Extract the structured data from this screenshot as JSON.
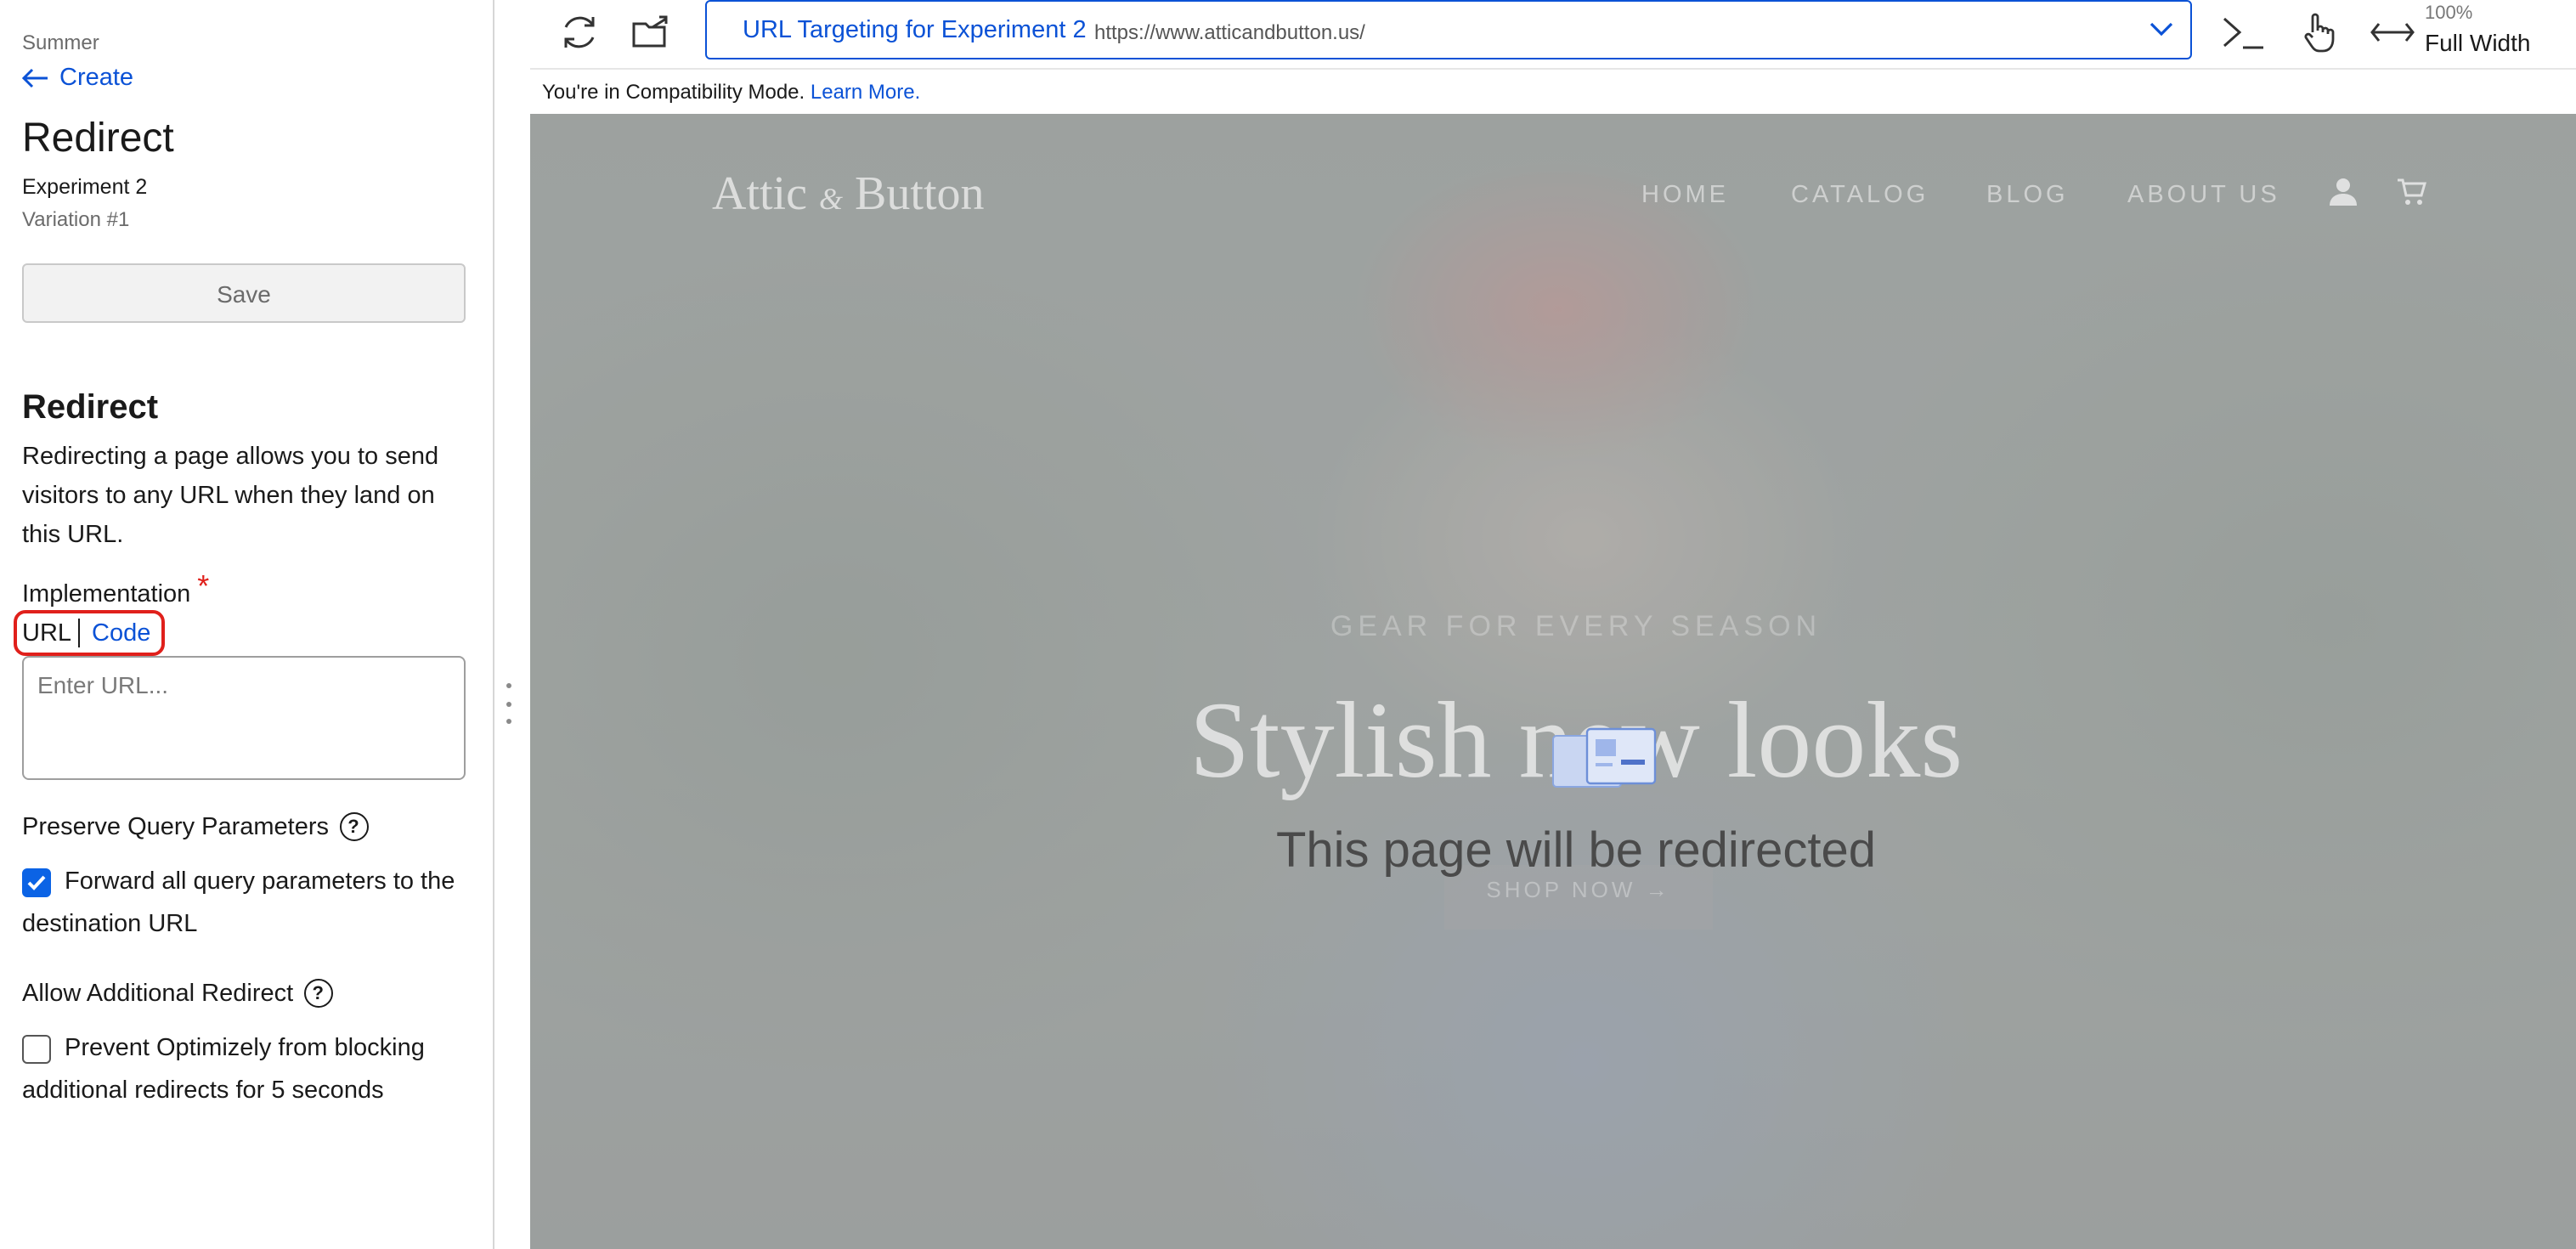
{
  "sidebar": {
    "breadcrumb": "Summer",
    "back_link": "Create",
    "page_title": "Redirect",
    "experiment_name": "Experiment 2",
    "variation_name": "Variation #1",
    "save_label": "Save",
    "section_title": "Redirect",
    "section_description": "Redirecting a page allows you to send visitors to any URL when they land on this URL.",
    "implementation_label": "Implementation",
    "required_marker": "*",
    "implementation_options": [
      "URL",
      "Code"
    ],
    "selected_implementation": "URL",
    "url_placeholder": "Enter URL...",
    "url_value": "",
    "preserve_query_label": "Preserve Query Parameters",
    "preserve_query_checkbox": "Forward all query parameters to the destination URL",
    "preserve_query_checked": true,
    "additional_redirect_label": "Allow Additional Redirect",
    "additional_redirect_checkbox": "Prevent Optimizely from blocking additional redirects for 5 seconds",
    "additional_redirect_checked": false,
    "help_glyph": "?"
  },
  "toolbar": {
    "refresh_icon": "refresh-icon",
    "open_external_icon": "open-external-icon",
    "page_select_title": "URL Targeting for Experiment 2",
    "page_select_url": "https://www.atticandbutton.us/",
    "code_icon": "code-editor-icon",
    "interactive_icon": "pointer-hand-icon",
    "width_icon": "width-arrows-icon",
    "zoom_percent": "100%",
    "zoom_label": "Full Width"
  },
  "compat_bar": {
    "text": "You're in Compatibility Mode.",
    "link": "Learn More."
  },
  "preview": {
    "logo_main": "Attic",
    "logo_amp": "&",
    "logo_end": "Button",
    "nav": [
      "HOME",
      "CATALOG",
      "BLOG",
      "ABOUT US"
    ],
    "hero_kicker": "GEAR FOR EVERY SEASON",
    "hero_headline": "Stylish new looks",
    "shop_now": "SHOP NOW →",
    "redirect_message": "This page will be redirected"
  },
  "colors": {
    "link_blue": "#0b52d6",
    "required_red": "#e0201b",
    "checkbox_blue": "#0b63e5",
    "highlight_red": "#e0201b"
  }
}
